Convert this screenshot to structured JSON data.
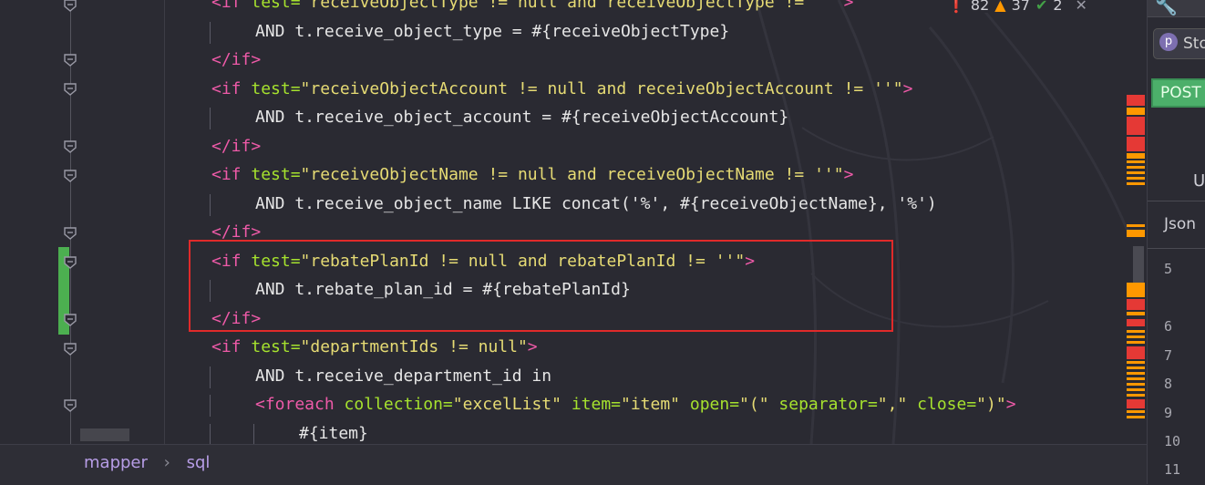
{
  "inspection": {
    "errors": "82",
    "warnings": "37",
    "ok": "2"
  },
  "code_lines": [
    {
      "indent": 0,
      "tokens": [
        [
          "tag",
          "<if "
        ],
        [
          "attr",
          "test="
        ],
        [
          "str",
          "\"receiveObjectType != null and receiveObjectType != ''\""
        ],
        [
          "tag",
          ">"
        ]
      ]
    },
    {
      "indent": 1,
      "tokens": [
        [
          "plain",
          "AND t.receive_object_type = #{receiveObjectType}"
        ]
      ]
    },
    {
      "indent": 0,
      "tokens": [
        [
          "tag",
          "</if>"
        ]
      ]
    },
    {
      "indent": 0,
      "tokens": [
        [
          "tag",
          "<if "
        ],
        [
          "attr",
          "test="
        ],
        [
          "str",
          "\"receiveObjectAccount != null and receiveObjectAccount != ''\""
        ],
        [
          "tag",
          ">"
        ]
      ]
    },
    {
      "indent": 1,
      "tokens": [
        [
          "plain",
          "AND t.receive_object_account = #{receiveObjectAccount}"
        ]
      ]
    },
    {
      "indent": 0,
      "tokens": [
        [
          "tag",
          "</if>"
        ]
      ]
    },
    {
      "indent": 0,
      "tokens": [
        [
          "tag",
          "<if "
        ],
        [
          "attr",
          "test="
        ],
        [
          "str",
          "\"receiveObjectName != null and receiveObjectName != ''\""
        ],
        [
          "tag",
          ">"
        ]
      ]
    },
    {
      "indent": 1,
      "tokens": [
        [
          "plain",
          "AND t.receive_object_name LIKE concat('%', #{receiveObjectName}, '%')"
        ]
      ]
    },
    {
      "indent": 0,
      "tokens": [
        [
          "tag",
          "</if>"
        ]
      ]
    },
    {
      "indent": 0,
      "tokens": [
        [
          "tag",
          "<if "
        ],
        [
          "attr",
          "test="
        ],
        [
          "str",
          "\"rebatePlanId != null and rebatePlanId != ''\""
        ],
        [
          "tag",
          ">"
        ]
      ]
    },
    {
      "indent": 1,
      "tokens": [
        [
          "plain",
          "AND t.rebate_plan_id = #{rebatePlanId}"
        ]
      ]
    },
    {
      "indent": 0,
      "tokens": [
        [
          "tag",
          "</if>"
        ]
      ]
    },
    {
      "indent": 0,
      "tokens": [
        [
          "tag",
          "<if "
        ],
        [
          "attr",
          "test="
        ],
        [
          "str",
          "\"departmentIds != null\""
        ],
        [
          "tag",
          ">"
        ]
      ]
    },
    {
      "indent": 1,
      "tokens": [
        [
          "plain",
          "AND t.receive_department_id in"
        ]
      ]
    },
    {
      "indent": 1,
      "tokens": [
        [
          "tag",
          "<foreach "
        ],
        [
          "attr",
          "collection="
        ],
        [
          "str",
          "\"excelList\" "
        ],
        [
          "attr",
          "item="
        ],
        [
          "str",
          "\"item\" "
        ],
        [
          "attr",
          "open="
        ],
        [
          "str",
          "\"(\" "
        ],
        [
          "attr",
          "separator="
        ],
        [
          "str",
          "\",\" "
        ],
        [
          "attr",
          "close="
        ],
        [
          "str",
          "\")\""
        ],
        [
          "tag",
          ">"
        ]
      ]
    },
    {
      "indent": 2,
      "tokens": [
        [
          "plain",
          "#{item}"
        ]
      ]
    }
  ],
  "breadcrumb": {
    "items": [
      "mapper",
      "sql"
    ]
  },
  "right_panel": {
    "store_button": "Sto",
    "store_badge": "p",
    "method": "POST",
    "u_label": "U",
    "json_tab": "Json",
    "line_numbers": [
      "5",
      "6",
      "7",
      "8",
      "9",
      "10",
      "11"
    ]
  },
  "colors": {
    "tag": "#ee5aa8",
    "attr": "#a6e22e",
    "str": "#e6db74",
    "text": "#e6e6e6",
    "highlight_box": "#e02a2a",
    "changed_gutter": "#4caf50"
  }
}
